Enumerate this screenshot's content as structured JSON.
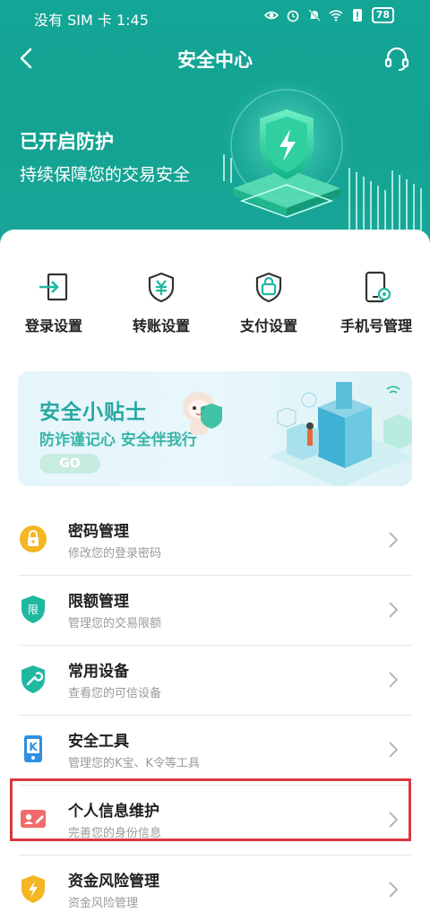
{
  "status_bar": {
    "carrier_time": "没有 SIM 卡 1:45",
    "battery": "78"
  },
  "header": {
    "title": "安全中心"
  },
  "hero": {
    "title": "已开启防护",
    "subtitle": "持续保障您的交易安全"
  },
  "quick_actions": [
    {
      "label": "登录设置",
      "icon": "login-icon"
    },
    {
      "label": "转账设置",
      "icon": "transfer-shield-icon"
    },
    {
      "label": "支付设置",
      "icon": "payment-lock-icon"
    },
    {
      "label": "手机号管理",
      "icon": "phone-settings-icon"
    }
  ],
  "banner": {
    "title": "安全小贴士",
    "subtitle": "防诈谨记心 安全伴我行",
    "button": "GO"
  },
  "menu": [
    {
      "title": "密码管理",
      "subtitle": "修改您的登录密码",
      "icon": "password-lock-icon",
      "color": "#f4b623"
    },
    {
      "title": "限额管理",
      "subtitle": "管理您的交易限额",
      "icon": "limit-shield-icon",
      "color": "#20b8a0"
    },
    {
      "title": "常用设备",
      "subtitle": "查看您的可信设备",
      "icon": "device-wrench-icon",
      "color": "#20b8a0"
    },
    {
      "title": "安全工具",
      "subtitle": "管理您的K宝、K令等工具",
      "icon": "k-token-icon",
      "color": "#2f8fe0"
    },
    {
      "title": "个人信息维护",
      "subtitle": "完善您的身份信息",
      "icon": "id-card-icon",
      "color": "#f26b6b"
    },
    {
      "title": "资金风险管理",
      "subtitle": "资金风险管理",
      "icon": "fund-risk-shield-icon",
      "color": "#f4b623"
    }
  ],
  "colors": {
    "brand": "#14a392",
    "highlight": "#d8383e"
  }
}
